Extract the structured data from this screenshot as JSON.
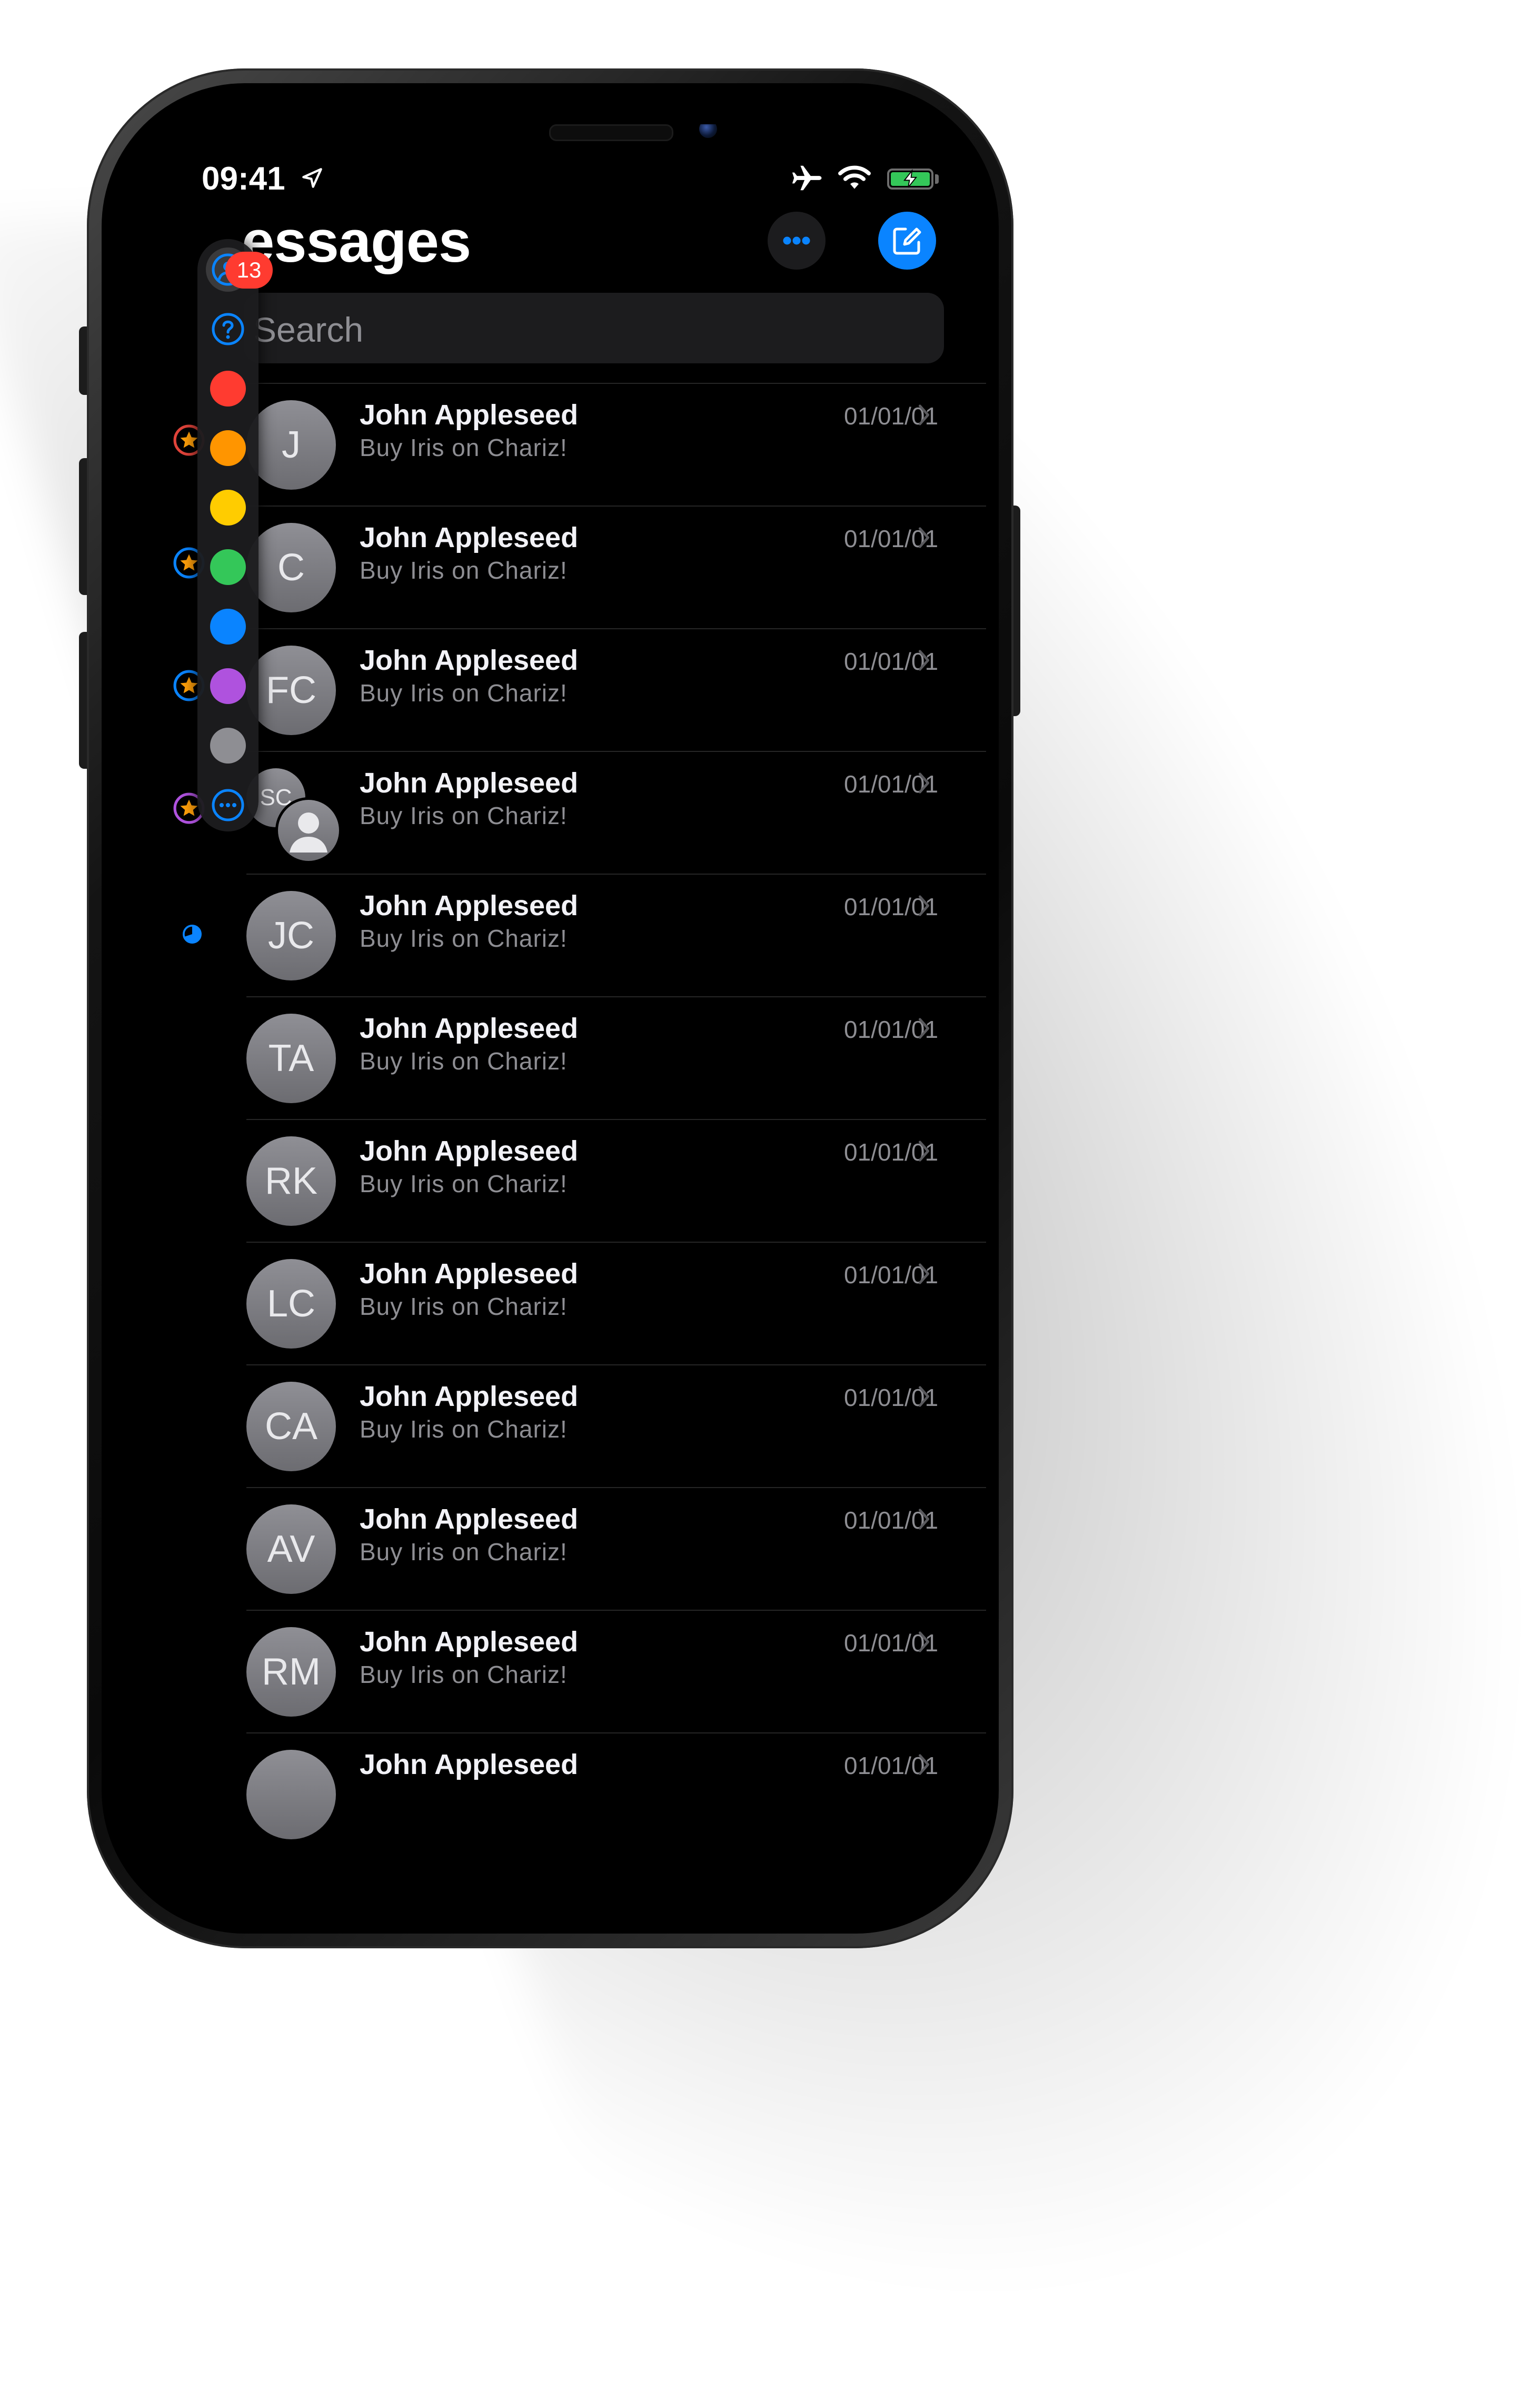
{
  "status_bar": {
    "time": "09:41"
  },
  "header": {
    "title": "essages"
  },
  "search": {
    "placeholder": "Search"
  },
  "picker": {
    "badge_count": "13",
    "colors": [
      "#ff3b30",
      "#ff9500",
      "#ffcc00",
      "#34c759",
      "#0a84ff",
      "#af52de",
      "#8e8e93"
    ]
  },
  "conversations": [
    {
      "initials": "J",
      "name": "John Appleseed",
      "preview": "Buy Iris on Chariz!",
      "date": "01/01/01",
      "flag": "red"
    },
    {
      "initials": "C",
      "name": "John Appleseed",
      "preview": "Buy Iris on Chariz!",
      "date": "01/01/01",
      "flag": "blue"
    },
    {
      "initials": "FC",
      "name": "John Appleseed",
      "preview": "Buy Iris on Chariz!",
      "date": "01/01/01",
      "flag": "blue"
    },
    {
      "initials": "SC",
      "name": "John Appleseed",
      "preview": "Buy Iris on Chariz!",
      "date": "01/01/01",
      "flag": "purple"
    },
    {
      "initials": "JC",
      "name": "John Appleseed",
      "preview": "Buy Iris on Chariz!",
      "date": "01/01/01",
      "flag": "partial"
    },
    {
      "initials": "TA",
      "name": "John Appleseed",
      "preview": "Buy Iris on Chariz!",
      "date": "01/01/01",
      "flag": ""
    },
    {
      "initials": "RK",
      "name": "John Appleseed",
      "preview": "Buy Iris on Chariz!",
      "date": "01/01/01",
      "flag": ""
    },
    {
      "initials": "LC",
      "name": "John Appleseed",
      "preview": "Buy Iris on Chariz!",
      "date": "01/01/01",
      "flag": ""
    },
    {
      "initials": "CA",
      "name": "John Appleseed",
      "preview": "Buy Iris on Chariz!",
      "date": "01/01/01",
      "flag": ""
    },
    {
      "initials": "AV",
      "name": "John Appleseed",
      "preview": "Buy Iris on Chariz!",
      "date": "01/01/01",
      "flag": ""
    },
    {
      "initials": "RM",
      "name": "John Appleseed",
      "preview": "Buy Iris on Chariz!",
      "date": "01/01/01",
      "flag": ""
    },
    {
      "initials": "",
      "name": "John Appleseed",
      "preview": "",
      "date": "01/01/01",
      "flag": ""
    }
  ],
  "colors": {
    "accent": "#0a84ff",
    "badge": "#ff3b30",
    "flag_star": "#ff9f0a",
    "flag_red": "#e0433a",
    "flag_blue": "#0a84ff",
    "flag_purple": "#af52de"
  }
}
